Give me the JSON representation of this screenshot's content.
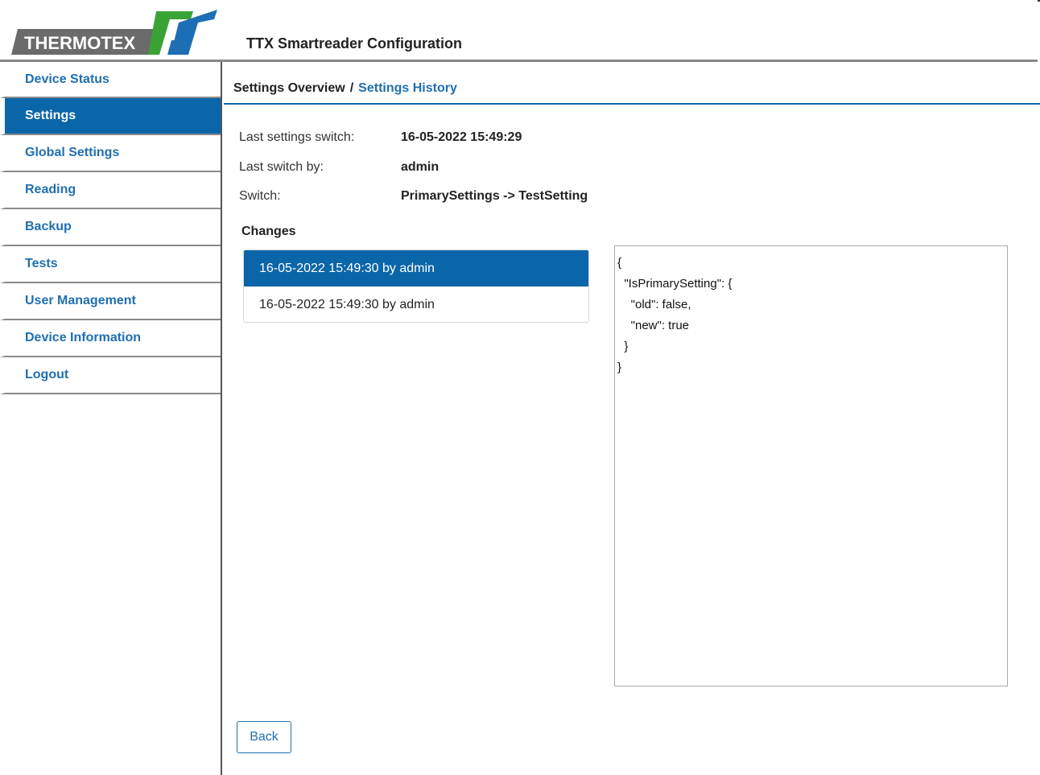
{
  "header": {
    "logo_text": "THERMOTEX",
    "title": "TTX Smartreader Configuration"
  },
  "sidebar": {
    "items": [
      {
        "label": "Device Status"
      },
      {
        "label": "Settings",
        "active": true
      },
      {
        "label": "Global Settings"
      },
      {
        "label": "Reading"
      },
      {
        "label": "Backup"
      },
      {
        "label": "Tests"
      },
      {
        "label": "User Management"
      },
      {
        "label": "Device Information"
      },
      {
        "label": "Logout"
      }
    ]
  },
  "breadcrumb": {
    "current": "Settings Overview",
    "separator": "/",
    "link": "Settings History"
  },
  "info": {
    "last_switch_label": "Last settings switch:",
    "last_switch_value": "16-05-2022 15:49:29",
    "switch_by_label": "Last switch by:",
    "switch_by_value": "admin",
    "switch_label": "Switch:",
    "switch_value": "PrimarySettings -> TestSetting"
  },
  "changes": {
    "title": "Changes",
    "items": [
      {
        "label": "16-05-2022 15:49:30 by admin",
        "selected": true
      },
      {
        "label": "16-05-2022 15:49:30 by admin",
        "selected": false
      }
    ],
    "detail": "{\n  \"IsPrimarySetting\": {\n    \"old\": false,\n    \"new\": true\n  }\n}"
  },
  "actions": {
    "back_label": "Back"
  },
  "colors": {
    "accent": "#0b66a9",
    "link": "#1f6fb0",
    "logo_green": "#3aa336",
    "logo_blue": "#1d6fb5"
  }
}
